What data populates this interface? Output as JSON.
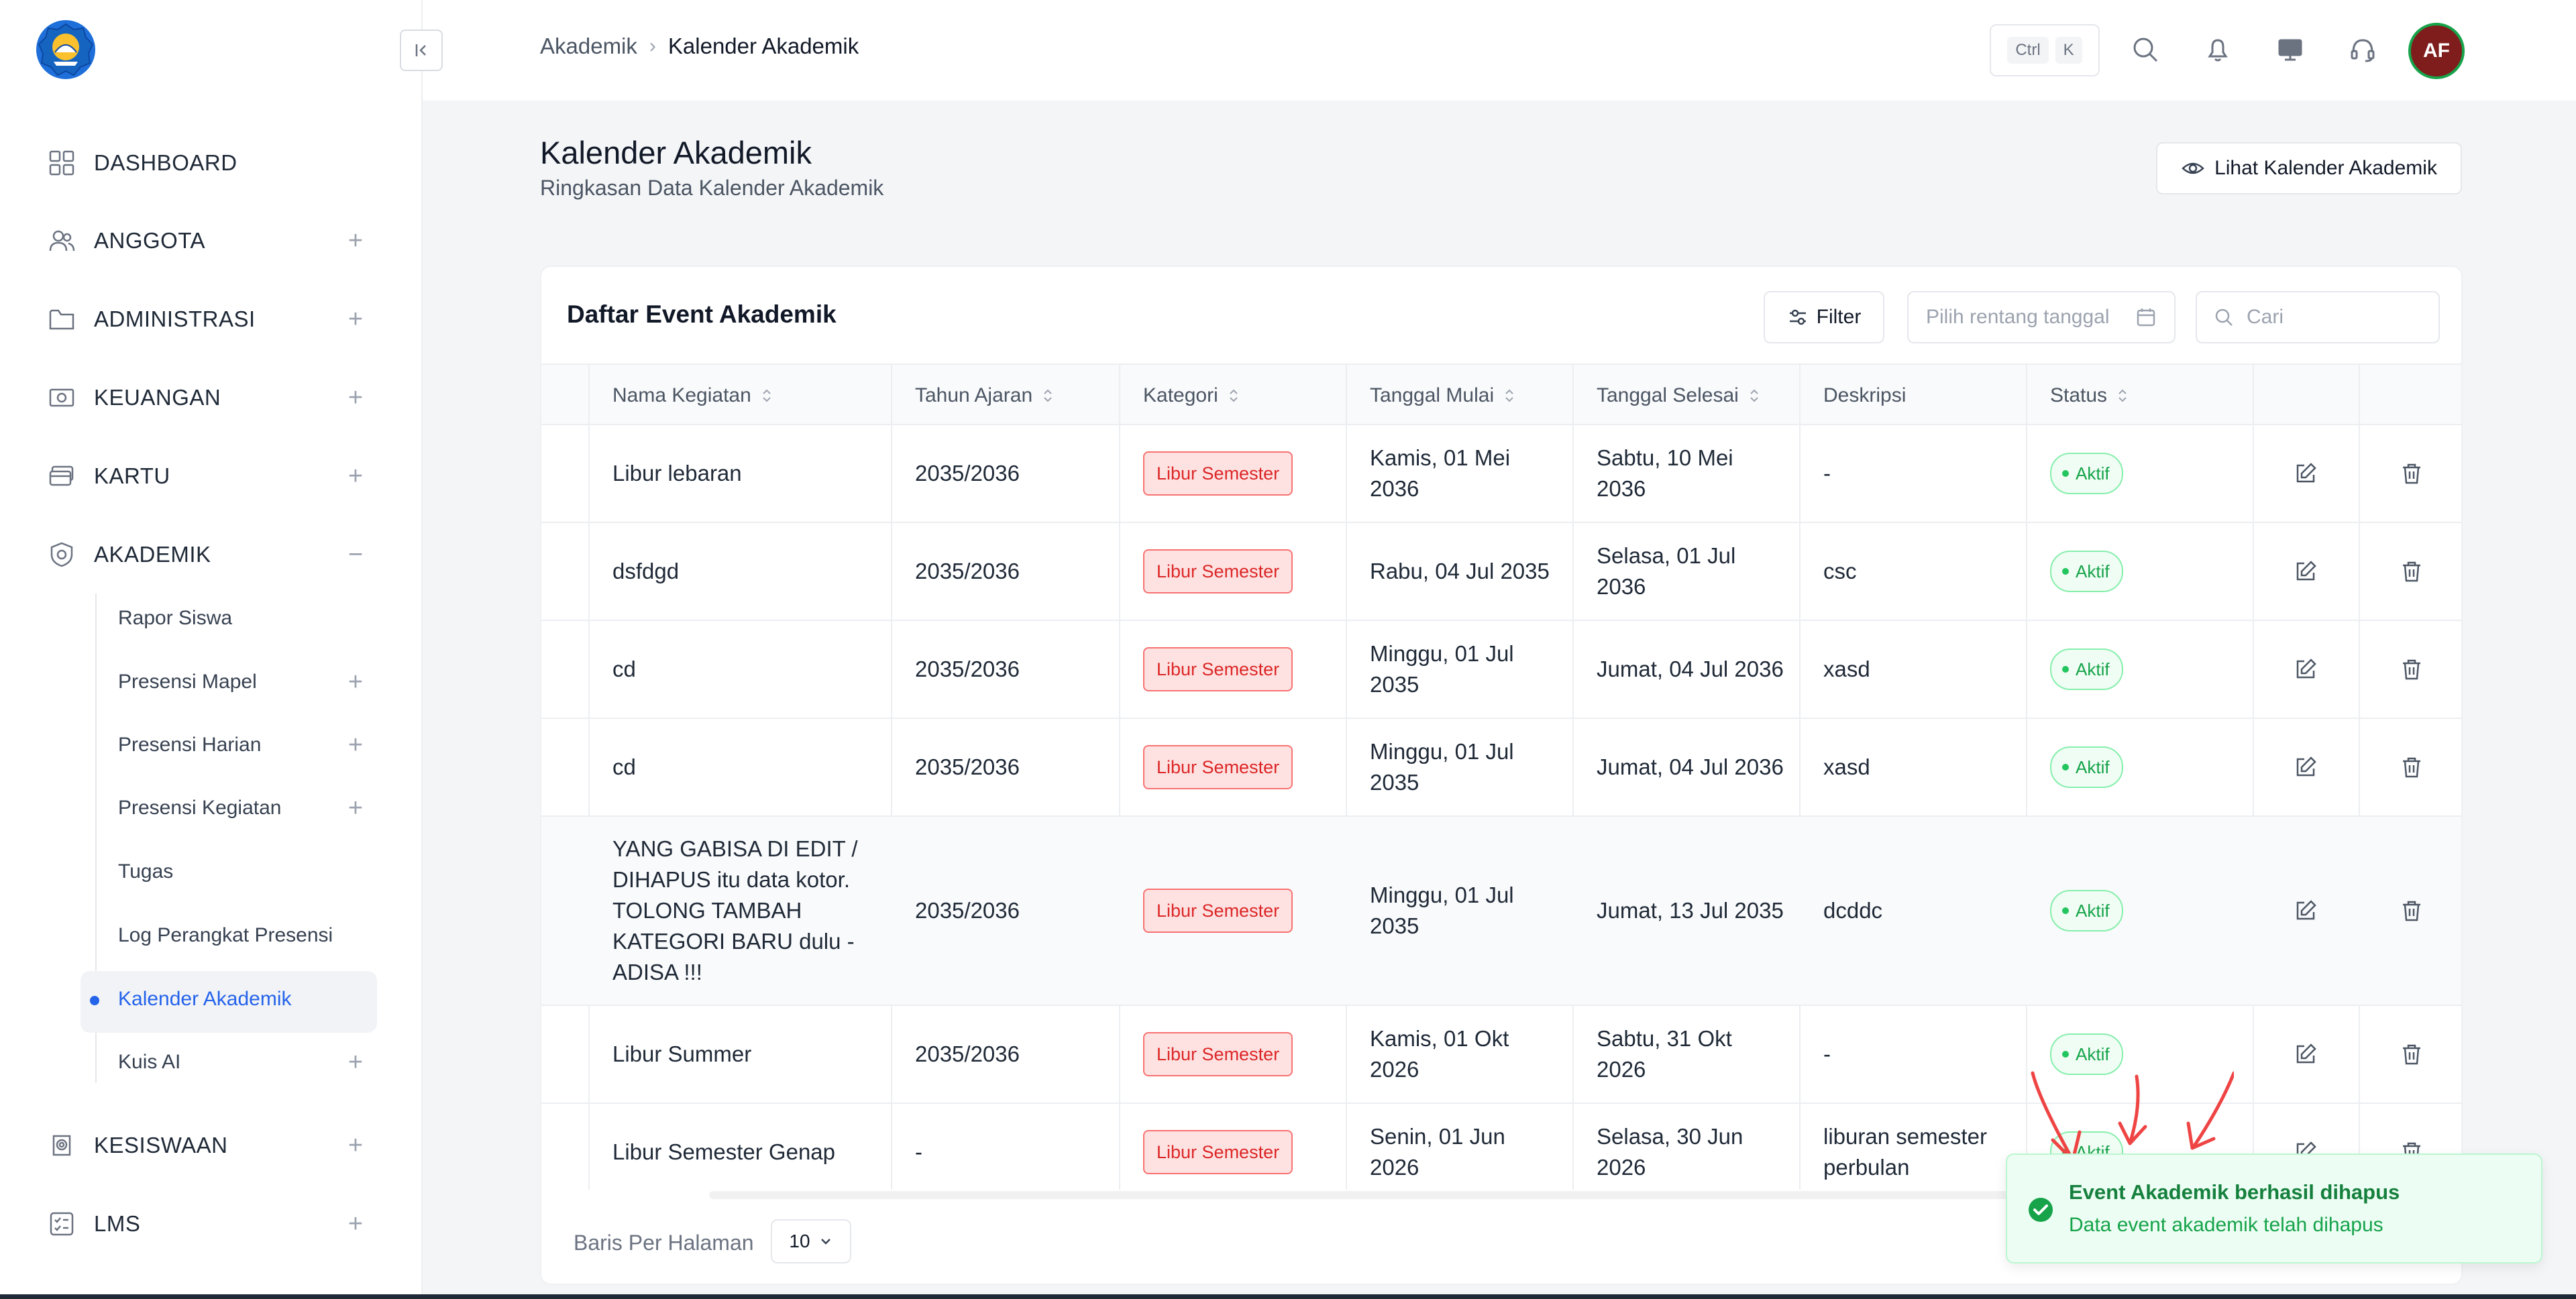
{
  "sidebar": {
    "items": [
      {
        "label": "DASHBOARD",
        "icon": "grid-icon",
        "toggle": ""
      },
      {
        "label": "ANGGOTA",
        "icon": "users-icon",
        "toggle": "+"
      },
      {
        "label": "ADMINISTRASI",
        "icon": "folder-icon",
        "toggle": "+"
      },
      {
        "label": "KEUANGAN",
        "icon": "money-icon",
        "toggle": "+"
      },
      {
        "label": "KARTU",
        "icon": "card-icon",
        "toggle": "+"
      },
      {
        "label": "AKADEMIK",
        "icon": "academic-shield-icon",
        "toggle": "−"
      },
      {
        "label": "KESISWAAN",
        "icon": "student-badge-icon",
        "toggle": "+"
      },
      {
        "label": "LMS",
        "icon": "checklist-icon",
        "toggle": "+"
      }
    ],
    "akademik_sub": [
      {
        "label": "Rapor Siswa",
        "toggle": ""
      },
      {
        "label": "Presensi Mapel",
        "toggle": "+"
      },
      {
        "label": "Presensi Harian",
        "toggle": "+"
      },
      {
        "label": "Presensi Kegiatan",
        "toggle": "+"
      },
      {
        "label": "Tugas",
        "toggle": ""
      },
      {
        "label": "Log Perangkat Presensi",
        "toggle": ""
      },
      {
        "label": "Kalender Akademik",
        "toggle": "",
        "active": true
      },
      {
        "label": "Kuis AI",
        "toggle": "+"
      }
    ]
  },
  "topbar": {
    "breadcrumb": [
      "Akademik",
      "Kalender Akademik"
    ],
    "shortcut_keys": [
      "Ctrl",
      "K"
    ],
    "avatar_initials": "AF"
  },
  "page": {
    "title": "Kalender Akademik",
    "subtitle": "Ringkasan Data Kalender Akademik",
    "view_calendar_label": "Lihat Kalender Akademik"
  },
  "card": {
    "title": "Daftar Event Akademik",
    "filter_label": "Filter",
    "date_range_placeholder": "Pilih rentang tanggal",
    "search_placeholder": "Cari"
  },
  "table": {
    "columns": [
      "Nama Kegiatan",
      "Tahun Ajaran",
      "Kategori",
      "Tanggal Mulai",
      "Tanggal Selesai",
      "Deskripsi",
      "Status"
    ],
    "rows": [
      {
        "name": "Libur lebaran",
        "year": "2035/2036",
        "category": "Libur Semester",
        "start": "Kamis, 01 Mei 2036",
        "end": "Sabtu, 10 Mei 2036",
        "desc": "-",
        "status": "Aktif"
      },
      {
        "name": "dsfdgd",
        "year": "2035/2036",
        "category": "Libur Semester",
        "start": "Rabu, 04 Jul 2035",
        "end": "Selasa, 01 Jul 2036",
        "desc": "csc",
        "status": "Aktif"
      },
      {
        "name": "cd",
        "year": "2035/2036",
        "category": "Libur Semester",
        "start": "Minggu, 01 Jul 2035",
        "end": "Jumat, 04 Jul 2036",
        "desc": "xasd",
        "status": "Aktif"
      },
      {
        "name": "cd",
        "year": "2035/2036",
        "category": "Libur Semester",
        "start": "Minggu, 01 Jul 2035",
        "end": "Jumat, 04 Jul 2036",
        "desc": "xasd",
        "status": "Aktif"
      },
      {
        "name": "YANG GABISA DI EDIT / DIHAPUS itu data kotor. TOLONG TAMBAH KATEGORI BARU dulu - ADISA !!!",
        "year": "2035/2036",
        "category": "Libur Semester",
        "start": "Minggu, 01 Jul 2035",
        "end": "Jumat, 13 Jul 2035",
        "desc": "dcddc",
        "status": "Aktif"
      },
      {
        "name": "Libur Summer",
        "year": "2035/2036",
        "category": "Libur Semester",
        "start": "Kamis, 01 Okt 2026",
        "end": "Sabtu, 31 Okt 2026",
        "desc": "-",
        "status": "Aktif"
      },
      {
        "name": "Libur Semester Genap",
        "year": "-",
        "category": "Libur Semester",
        "start": "Senin, 01 Jun 2026",
        "end": "Selasa, 30 Jun 2026",
        "desc": "liburan semester perbulan",
        "status": "Aktif"
      }
    ]
  },
  "footer": {
    "rows_per_page_label": "Baris Per Halaman",
    "rows_per_page_value": "10"
  },
  "toast": {
    "title": "Event Akademik berhasil dihapus",
    "message": "Data event akademik telah dihapus"
  },
  "colors": {
    "accent": "#2563eb",
    "success": "#16a34a",
    "danger": "#dc2626",
    "annotation": "#ef4444"
  }
}
